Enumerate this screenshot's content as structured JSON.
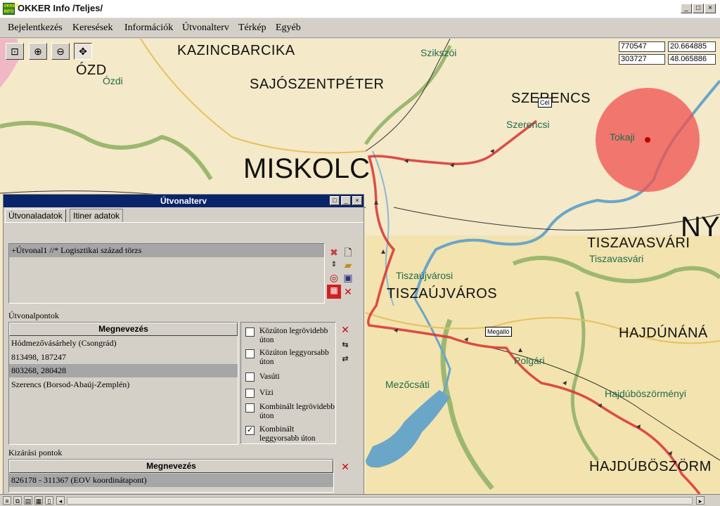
{
  "window": {
    "title": "OKKER Info /Teljes/",
    "icon_label": "OKKER INFO",
    "controls": [
      "_",
      "□",
      "×"
    ]
  },
  "menu": [
    "Bejelentkezés",
    "Keresések",
    "Információk",
    "Útvonalterv",
    "Térkép",
    "Egyéb"
  ],
  "map": {
    "toolbar": [
      "zoom-extent-icon",
      "zoom-in-icon",
      "zoom-out-icon",
      "pan-icon"
    ],
    "coords": {
      "x1": "770547",
      "x2": "20.664885",
      "y1": "303727",
      "y2": "48.065886"
    },
    "labels_big": {
      "kazincbarcika": "KAZINCBARCIKA",
      "ozd": "ÓZD",
      "sajoszentpeter": "SAJÓSZENTPÉTER",
      "szerencs": "SZERENCS",
      "miskolc": "MISKOLC",
      "tiszavasvari": "TISZAVASVÁRI",
      "tiszaujvaros": "TISZAÚJVÁROS",
      "hajdunanas": "HAJDÚNÁNÁ",
      "hajduboszorm": "HAJDÚBÖSZÖRM",
      "ny": "NY"
    },
    "labels_small": {
      "ozdi": "Ózdi",
      "szikszoi": "Szikszói",
      "szerencsi": "Szerencsi",
      "tokaji": "Tokaji",
      "tiszavasvari": "Tiszavasvári",
      "tiszaujvarosi": "Tiszaújvárosi",
      "polgari": "Polgári",
      "mezocsati": "Mezőcsáti",
      "hajduboszormenyi": "Hajdúböszörményi"
    },
    "markers": {
      "cel": "Cél",
      "megallo": "Megálló"
    }
  },
  "panel": {
    "title": "Útvonalterv",
    "tabs": [
      "Útvonaladatok",
      "Itiner adatok"
    ],
    "route_item": "+Útvonal1 //* Logisztikai század törzs",
    "waypoints_label": "Útvonalpontok",
    "column_header": "Megnevezés",
    "waypoints": [
      "Hódmezővásárhely (Csongrád)",
      "813498, 187247",
      "803268, 280428",
      "Szerencs (Borsod-Abaúj-Zemplén)"
    ],
    "selected_index": 2,
    "options": [
      {
        "label": "Közúton legrövidebb úton",
        "checked": false
      },
      {
        "label": "Közúton leggyorsabb úton",
        "checked": false
      },
      {
        "label": "Vasúti",
        "checked": false
      },
      {
        "label": "Vízi",
        "checked": false
      },
      {
        "label": "Kombinált legrövidebb úton",
        "checked": false
      },
      {
        "label": "Kombinált leggyorsabb úton",
        "checked": true
      }
    ],
    "exclusion_label": "Kizárási pontok",
    "exclusions": [
      "826178 - 311367 (EOV koordinátapont)"
    ]
  },
  "colors": {
    "route": "#d83030",
    "circle": "#f05050",
    "river": "#6aa6c8",
    "green_boundary": "#9cb870",
    "title_active": "#0a246a"
  }
}
